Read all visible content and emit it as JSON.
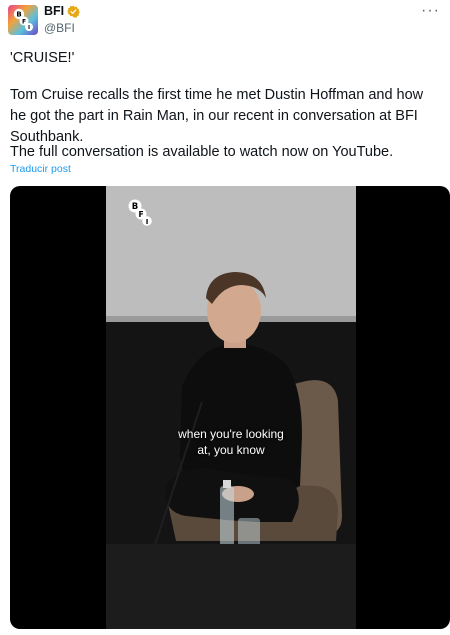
{
  "account": {
    "display_name": "BFI",
    "handle": "@BFI"
  },
  "tweet": {
    "paragraph1": "'CRUISE!'",
    "paragraph2": "Tom Cruise recalls the first time he met Dustin Hoffman and how he got the part in Rain Man, in our recent in conversation at BFI Southbank.",
    "paragraph3": "The full conversation is available to watch now on YouTube.",
    "translate_label": "Traducir post"
  },
  "video": {
    "subtitle_line1": "when you're looking",
    "subtitle_line2": "at, you know",
    "logo_letters": [
      "B",
      "F",
      "I"
    ]
  },
  "icons": {
    "more": "more-options-icon",
    "verified": "verified-badge-icon",
    "avatar": "bfi-avatar-logo"
  },
  "colors": {
    "link": "#1d9bf0",
    "verified": "#e6a817",
    "muted": "#536471"
  }
}
